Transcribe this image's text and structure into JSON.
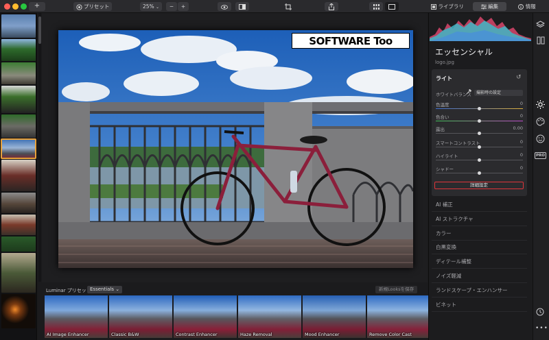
{
  "toolbar": {
    "add_label": "+",
    "presets_label": "プリセット",
    "zoom_label": "25%",
    "zoom_minus": "−",
    "zoom_plus": "+",
    "tab_library": "ライブラリ",
    "tab_edit": "編集",
    "tab_info": "情報"
  },
  "watermark": "SOFTWARE Too",
  "panel": {
    "title": "エッセンシャル",
    "filename": "logo.jpg",
    "light": {
      "title": "ライト",
      "wb_label": "ホワイトバランス",
      "wb_value": "撮影時の設定",
      "sliders": [
        {
          "label": "色温度",
          "value": "0",
          "pos": 0.5
        },
        {
          "label": "色合い",
          "value": "0",
          "pos": 0.5
        },
        {
          "label": "露出",
          "value": "0.00",
          "pos": 0.5
        },
        {
          "label": "スマートコントラスト",
          "value": "0",
          "pos": 0.5
        },
        {
          "label": "ハイライト",
          "value": "0",
          "pos": 0.5
        },
        {
          "label": "シャドー",
          "value": "0",
          "pos": 0.5
        }
      ],
      "advanced_button": "詳細設定"
    },
    "sections": [
      "AI 補正",
      "AI ストラクチャ",
      "カラー",
      "白黒変換",
      "ディテール補整",
      "ノイズ軽減",
      "ランドスケープ・エンハンサー",
      "ビネット"
    ],
    "side_icons": {
      "pro_label": "PRO"
    }
  },
  "presets": {
    "label": "Luminar プリセット",
    "category": "Essentials",
    "save_button": "新規Looksを保存",
    "items": [
      "AI Image Enhancer",
      "Classic B&W",
      "Contrast Enhancer",
      "Haze Removal",
      "Mood Enhancer",
      "Remove Color Cast"
    ]
  },
  "colors": {
    "accent_red": "#e0353a",
    "traffic_red": "#ff5f57",
    "traffic_yellow": "#febc2e",
    "traffic_green": "#28c840"
  }
}
